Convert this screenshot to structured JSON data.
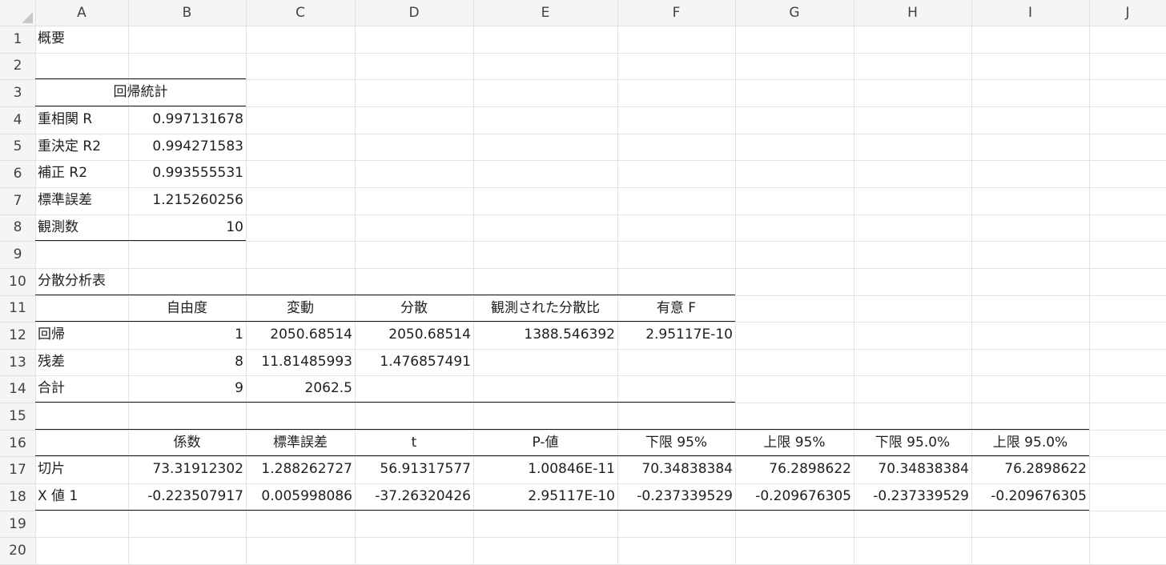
{
  "columns": [
    "A",
    "B",
    "C",
    "D",
    "E",
    "F",
    "G",
    "H",
    "I",
    "J"
  ],
  "rows": [
    "1",
    "2",
    "3",
    "4",
    "5",
    "6",
    "7",
    "8",
    "9",
    "10",
    "11",
    "12",
    "13",
    "14",
    "15",
    "16",
    "17",
    "18",
    "19",
    "20"
  ],
  "summary": {
    "title": "概要",
    "stats_header": "回帰統計",
    "stats": [
      {
        "label": "重相関 R",
        "value": "0.997131678"
      },
      {
        "label": "重決定 R2",
        "value": "0.994271583"
      },
      {
        "label": "補正 R2",
        "value": "0.993555531"
      },
      {
        "label": "標準誤差",
        "value": "1.215260256"
      },
      {
        "label": "観測数",
        "value": "10"
      }
    ]
  },
  "anova": {
    "title": "分散分析表",
    "headers": [
      "自由度",
      "変動",
      "分散",
      "観測された分散比",
      "有意 F"
    ],
    "rows": [
      {
        "label": "回帰",
        "values": [
          "1",
          "2050.68514",
          "2050.68514",
          "1388.546392",
          "2.95117E-10"
        ]
      },
      {
        "label": "残差",
        "values": [
          "8",
          "11.81485993",
          "1.476857491",
          "",
          ""
        ]
      },
      {
        "label": "合計",
        "values": [
          "9",
          "2062.5",
          "",
          "",
          ""
        ]
      }
    ]
  },
  "coefficients": {
    "headers": [
      "係数",
      "標準誤差",
      "t",
      "P-値",
      "下限 95%",
      "上限 95%",
      "下限 95.0%",
      "上限 95.0%"
    ],
    "rows": [
      {
        "label": "切片",
        "values": [
          "73.31912302",
          "1.288262727",
          "56.91317577",
          "1.00846E-11",
          "70.34838384",
          "76.2898622",
          "70.34838384",
          "76.2898622"
        ]
      },
      {
        "label": "X 値 1",
        "values": [
          "-0.223507917",
          "0.005998086",
          "-37.26320426",
          "2.95117E-10",
          "-0.237339529",
          "-0.209676305",
          "-0.237339529",
          "-0.209676305"
        ]
      }
    ]
  },
  "colors": {
    "gridline": "#e1e1e1",
    "header_bg": "#f5f5f5",
    "header_text": "#424242",
    "cell_text": "#1f1f1f",
    "table_border": "#1a1a1a"
  },
  "icons": {
    "corner": "select-all-triangle-icon"
  }
}
